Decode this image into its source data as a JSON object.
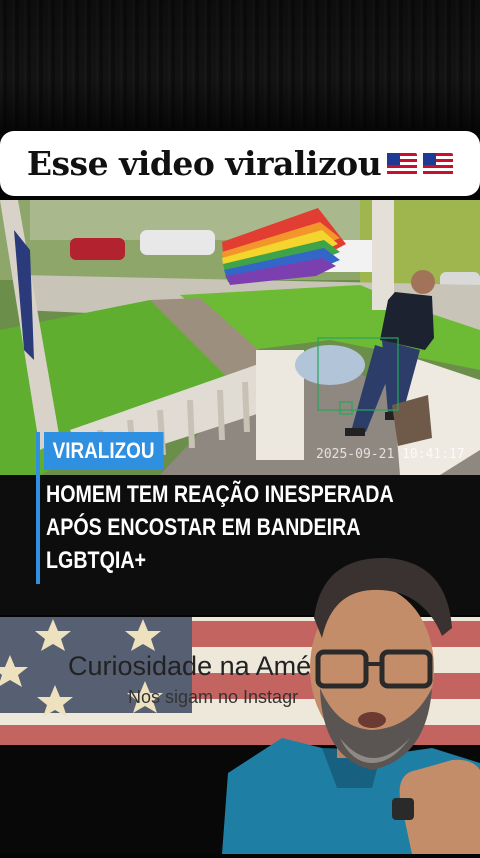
{
  "title_banner": {
    "text": "Esse video viralizou",
    "flag_icon": "us-flag-icon",
    "flag_count": 2
  },
  "video": {
    "timestamp": "2025-09-21 10:41:17"
  },
  "news": {
    "tag": "VIRALIZOU",
    "headline_lines": [
      "HOMEM TEM REAÇÃO INESPERADA",
      "APÓS ENCOSTAR EM BANDEIRA",
      "LGBTQIA+"
    ],
    "tag_color": "#2f8fe0"
  },
  "banner": {
    "title": "Curiosidade na Amér",
    "subtitle": "Nos sigam no Instagr"
  }
}
